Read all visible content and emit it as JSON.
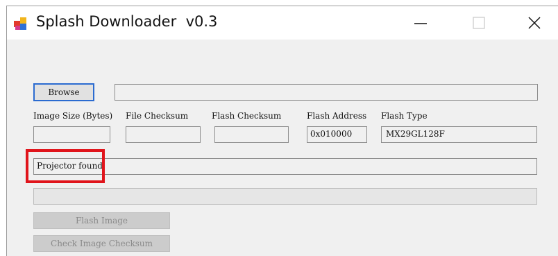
{
  "window": {
    "title": "Splash Downloader  v0.3"
  },
  "titlebar_buttons": {
    "minimize_icon": "minimize-icon",
    "maximize_icon": "maximize-icon",
    "close_icon": "close-icon"
  },
  "browse": {
    "button_label": "Browse",
    "path_value": ""
  },
  "fields": [
    {
      "label": "Image Size (Bytes)",
      "value": ""
    },
    {
      "label": "File Checksum",
      "value": ""
    },
    {
      "label": "Flash Checksum",
      "value": ""
    },
    {
      "label": "Flash Address",
      "value": "0x010000"
    },
    {
      "label": "Flash Type",
      "value": "MX29GL128F"
    }
  ],
  "status": {
    "text": "Projector found."
  },
  "progress": {
    "value": 0
  },
  "actions": {
    "flash_image_label": "Flash Image",
    "check_checksum_label": "Check Image Checksum"
  },
  "colors": {
    "highlight": "#e0141b",
    "focus_border": "#2b6bd0"
  }
}
